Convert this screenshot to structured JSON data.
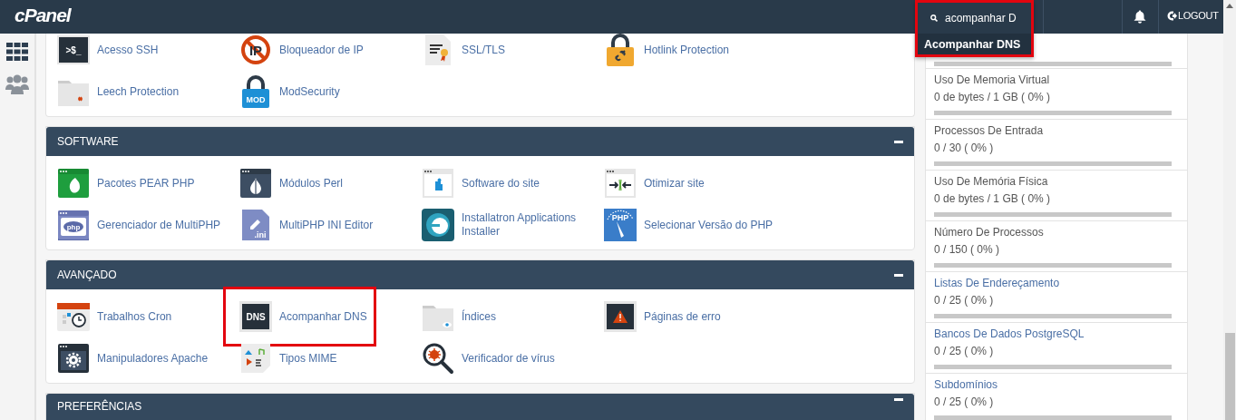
{
  "topbar": {
    "logo": "cPanel",
    "search": {
      "value": "acompanhar D",
      "highlighted": true,
      "suggestions": [
        {
          "label": "Acompanhar DNS",
          "selected": true
        }
      ]
    },
    "logout": "LOGOUT"
  },
  "sections": [
    {
      "items": [
        {
          "label": "Acesso SSH",
          "icon_text": ">$_"
        },
        {
          "label": "Bloqueador de IP",
          "icon_text": "IP"
        },
        {
          "label": "SSL/TLS"
        },
        {
          "label": "Hotlink Protection"
        },
        {
          "label": "Leech Protection"
        },
        {
          "label": "ModSecurity",
          "icon_text": "MOD"
        }
      ]
    },
    {
      "title": "SOFTWARE",
      "items": [
        {
          "label": "Pacotes PEAR PHP"
        },
        {
          "label": "Módulos Perl"
        },
        {
          "label": "Software do site"
        },
        {
          "label": "Otimizar site"
        },
        {
          "label": "Gerenciador de MultiPHP",
          "icon_text": "php"
        },
        {
          "label": "MultiPHP INI Editor",
          "icon_text": ".ini"
        },
        {
          "label": "Installatron Applications Installer"
        },
        {
          "label": "Selecionar Versão do PHP",
          "icon_text": "PHP"
        }
      ]
    },
    {
      "title": "AVANÇADO",
      "items": [
        {
          "label": "Trabalhos Cron"
        },
        {
          "label": "Acompanhar DNS",
          "icon_text": "DNS",
          "highlighted": true
        },
        {
          "label": "Índices"
        },
        {
          "label": "Páginas de erro"
        },
        {
          "label": "Manipuladores Apache"
        },
        {
          "label": "Tipos MIME"
        },
        {
          "label": "Verificador de vírus"
        }
      ]
    },
    {
      "title": "PREFERÊNCIAS"
    }
  ],
  "stats": [
    {
      "level": 0
    },
    {
      "title": "Uso De Memoria Virtual",
      "value": "0 de bytes / 1 GB ( 0% )",
      "link": false,
      "level": 0
    },
    {
      "title": "Processos De Entrada",
      "value": "0 / 30 ( 0% )",
      "link": false,
      "level": 0
    },
    {
      "title": "Uso De Memória Física",
      "value": "0 de bytes / 1 GB ( 0% )",
      "link": false,
      "level": 0
    },
    {
      "title": "Número De Processos",
      "value": "0 / 150 ( 0% )",
      "link": false,
      "level": 0
    },
    {
      "title": "Listas De Endereçamento",
      "value": "0 / 25 ( 0% )",
      "link": true,
      "level": 0
    },
    {
      "title": "Bancos De Dados PostgreSQL",
      "value": "0 / 25 ( 0% )",
      "link": true,
      "level": 0
    },
    {
      "title": "Subdomínios",
      "value": "0 / 25 ( 0% )",
      "link": true,
      "level": 0
    }
  ]
}
